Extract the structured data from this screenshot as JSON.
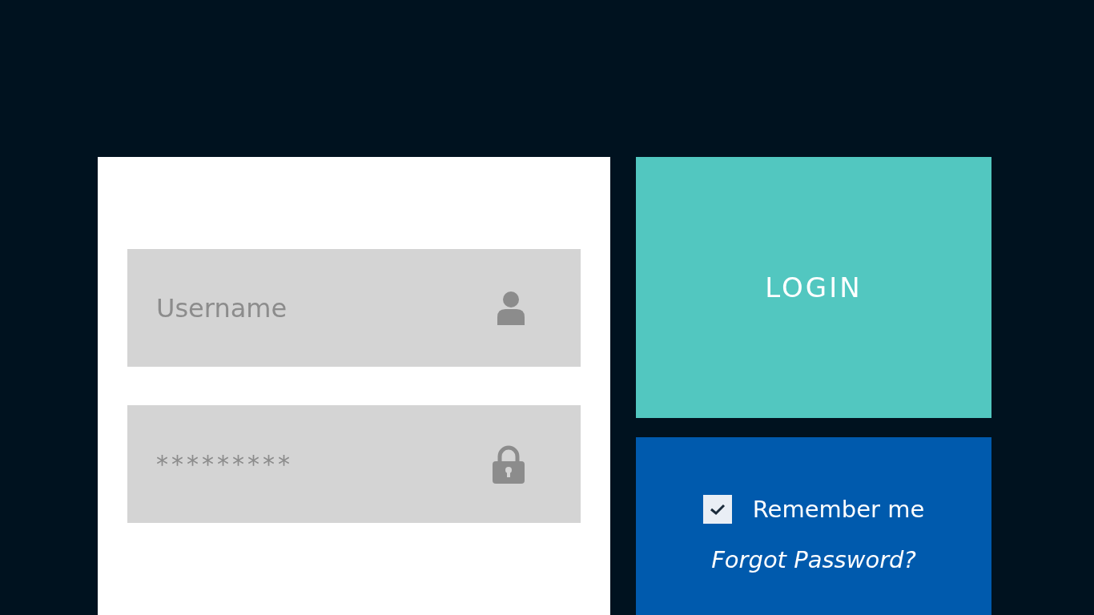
{
  "username_field": {
    "placeholder": "Username"
  },
  "password_field": {
    "value": "*********"
  },
  "login_button": {
    "label": "LOGIN"
  },
  "remember_me": {
    "label": "Remember me",
    "checked": true
  },
  "forgot_password": {
    "label": "Forgot Password?"
  }
}
